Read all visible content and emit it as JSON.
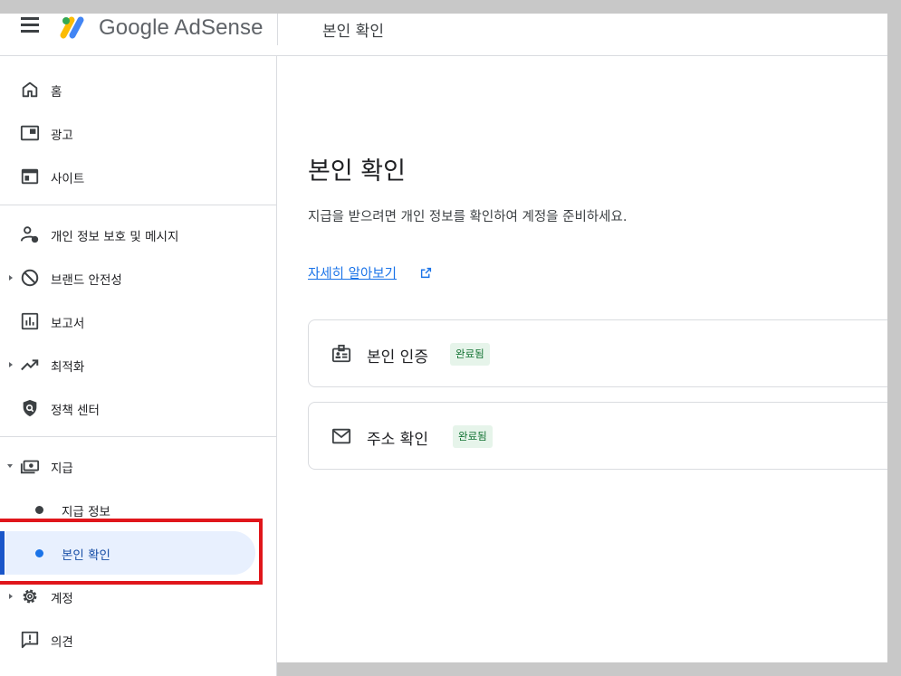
{
  "header": {
    "brand": "Google AdSense",
    "title": "본인 확인"
  },
  "sidebar": {
    "items": [
      {
        "label": "홈",
        "icon": "home-icon"
      },
      {
        "label": "광고",
        "icon": "ads-icon"
      },
      {
        "label": "사이트",
        "icon": "sites-icon"
      },
      {
        "label": "개인 정보 보호 및 메시지",
        "icon": "privacy-messaging-icon"
      },
      {
        "label": "브랜드 안전성",
        "icon": "brand-safety-icon"
      },
      {
        "label": "보고서",
        "icon": "reports-icon"
      },
      {
        "label": "최적화",
        "icon": "optimization-icon"
      },
      {
        "label": "정책 센터",
        "icon": "policy-center-icon"
      },
      {
        "label": "지급",
        "icon": "payments-icon"
      },
      {
        "label": "계정",
        "icon": "gear-icon"
      },
      {
        "label": "의견",
        "icon": "feedback-icon"
      }
    ],
    "payments_sub": [
      {
        "label": "지급 정보"
      },
      {
        "label": "본인 확인",
        "active": true
      }
    ]
  },
  "main": {
    "title": "본인 확인",
    "description": "지급을 받으려면 개인 정보를 확인하여 계정을 준비하세요.",
    "learn_more": "자세히 알아보기",
    "cards": [
      {
        "label": "본인 인증",
        "status": "완료됨",
        "icon": "id-badge-icon"
      },
      {
        "label": "주소 확인",
        "status": "완료됨",
        "icon": "mail-icon"
      }
    ]
  },
  "colors": {
    "accent": "#1a73e8",
    "active_bg": "#e8f0fe",
    "badge_bg": "#e6f4ea",
    "badge_text": "#137333",
    "highlight": "#e0161b"
  }
}
